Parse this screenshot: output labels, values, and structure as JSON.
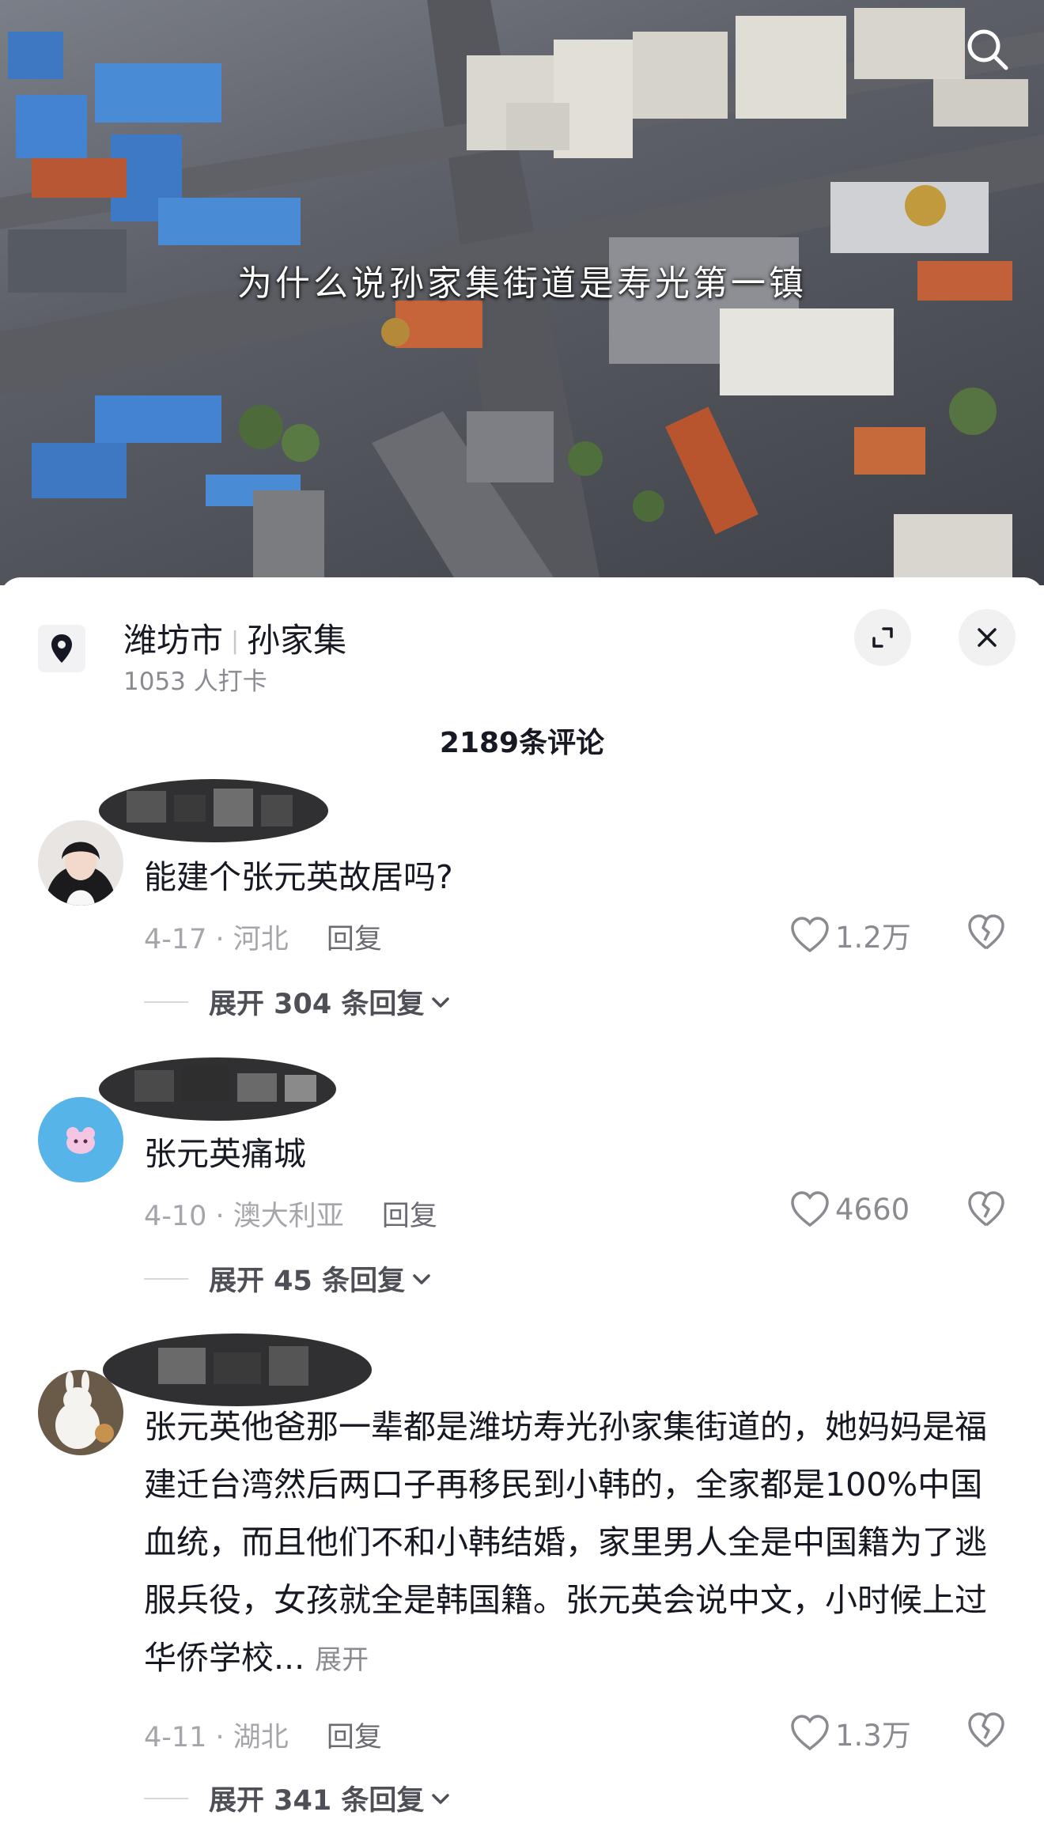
{
  "video": {
    "subtitle": "为什么说孙家集街道是寿光第一镇",
    "search_icon": "search-icon"
  },
  "location": {
    "city": "潍坊市",
    "place": "孙家集",
    "checkins": "1053 人打卡",
    "pin_icon": "location-pin-icon"
  },
  "comments_header": {
    "count_label": "2189条评论"
  },
  "comments": [
    {
      "text": "能建个张元英故居吗?",
      "date_location": "4-17 · 河北",
      "reply_label": "回复",
      "likes": "1.2万",
      "expand_label": "展开 304 条回复"
    },
    {
      "text": "张元英痛城",
      "date_location": "4-10 · 澳大利亚",
      "reply_label": "回复",
      "likes": "4660",
      "expand_label": "展开 45 条回复"
    },
    {
      "text": "张元英他爸那一辈都是潍坊寿光孙家集街道的，她妈妈是福建迁台湾然后两口子再移民到小韩的，全家都是100%中国血统，而且他们不和小韩结婚，家里男人全是中国籍为了逃服兵役，女孩就全是韩国籍。张元英会说中文，小时候上过华侨学校...",
      "more_label": "展开",
      "date_location": "4-11 · 湖北",
      "reply_label": "回复",
      "likes": "1.3万",
      "expand_label": "展开 341 条回复"
    }
  ],
  "colors": {
    "text_primary": "#161823",
    "text_secondary": "#8a8b91",
    "background": "#ffffff"
  }
}
